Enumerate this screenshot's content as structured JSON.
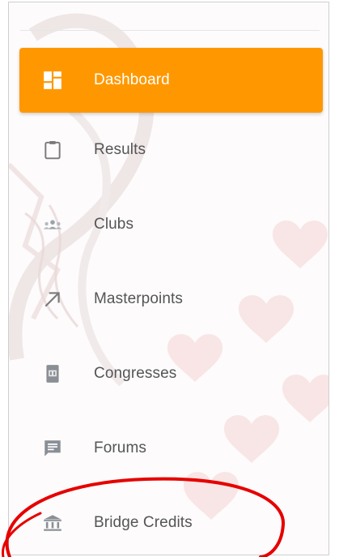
{
  "sidebar": {
    "items": [
      {
        "label": "Dashboard",
        "icon": "dashboard-icon",
        "active": true
      },
      {
        "label": "Results",
        "icon": "clipboard-icon",
        "active": false
      },
      {
        "label": "Clubs",
        "icon": "people-icon",
        "active": false
      },
      {
        "label": "Masterpoints",
        "icon": "arrow-up-right-icon",
        "active": false
      },
      {
        "label": "Congresses",
        "icon": "calendar-icon",
        "active": false
      },
      {
        "label": "Forums",
        "icon": "forum-icon",
        "active": false
      },
      {
        "label": "Bridge Credits",
        "icon": "bank-icon",
        "active": false
      }
    ]
  },
  "colors": {
    "accent": "#ff9800",
    "icon": "#8a8a8a",
    "text": "#555555",
    "annotation": "#e60000"
  }
}
